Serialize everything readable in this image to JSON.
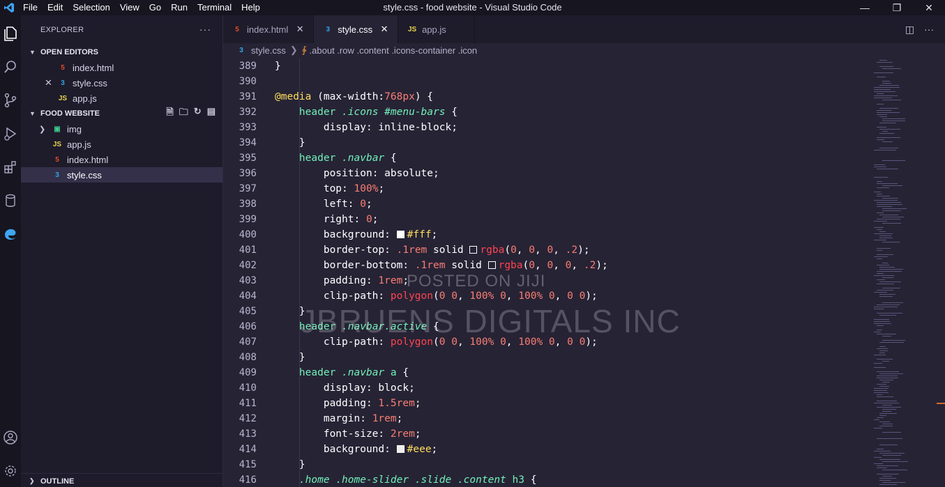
{
  "titlebar": {
    "menu": [
      "File",
      "Edit",
      "Selection",
      "View",
      "Go",
      "Run",
      "Terminal",
      "Help"
    ],
    "title": "style.css - food website - Visual Studio Code"
  },
  "sidebar": {
    "header": "EXPLORER",
    "open_editors_label": "OPEN EDITORS",
    "open_editors": [
      {
        "name": "index.html",
        "type": "html"
      },
      {
        "name": "style.css",
        "type": "css"
      },
      {
        "name": "app.js",
        "type": "js"
      }
    ],
    "project_label": "FOOD WEBSITE",
    "files": [
      {
        "name": "img",
        "type": "folder"
      },
      {
        "name": "app.js",
        "type": "js"
      },
      {
        "name": "index.html",
        "type": "html"
      },
      {
        "name": "style.css",
        "type": "css"
      }
    ],
    "outline_label": "OUTLINE"
  },
  "tabs": [
    {
      "label": "index.html",
      "type": "html"
    },
    {
      "label": "style.css",
      "type": "css"
    },
    {
      "label": "app.js",
      "type": "js"
    }
  ],
  "breadcrumb": {
    "file": "style.css",
    "symbol": ".about .row .content .icons-container .icon"
  },
  "editor": {
    "line_numbers": [
      "389",
      "390",
      "391",
      "392",
      "393",
      "394",
      "395",
      "396",
      "397",
      "398",
      "399",
      "400",
      "401",
      "402",
      "403",
      "404",
      "405",
      "406",
      "407",
      "408",
      "409",
      "410",
      "411",
      "412",
      "413",
      "414",
      "415",
      "416"
    ]
  },
  "watermark": {
    "line1": "POSTED ON JIJI",
    "line2": "JBRUENS DIGITALS INC"
  },
  "colors": {
    "background": "#262335",
    "sidebar": "#1e1b2b",
    "activity": "#171520",
    "keyword": "#fede5d",
    "selector": "#72f1b8",
    "number": "#f97e72",
    "function": "#fe4450"
  }
}
